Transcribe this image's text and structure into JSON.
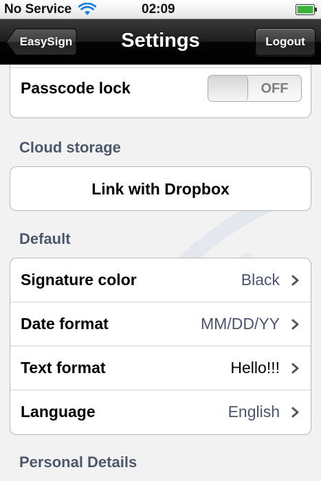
{
  "status_bar": {
    "carrier": "No Service",
    "time": "02:09"
  },
  "nav": {
    "back_label": "EasySign",
    "title": "Settings",
    "logout_label": "Logout"
  },
  "passcode": {
    "label": "Passcode lock",
    "toggle_state": "OFF"
  },
  "cloud": {
    "header": "Cloud storage",
    "link_label": "Link with Dropbox"
  },
  "default": {
    "header": "Default",
    "rows": [
      {
        "label": "Signature color",
        "value": "Black"
      },
      {
        "label": "Date format",
        "value": "MM/DD/YY"
      },
      {
        "label": "Text format",
        "value": "Hello!!!"
      },
      {
        "label": "Language",
        "value": "English"
      }
    ]
  },
  "personal": {
    "header": "Personal Details"
  },
  "colors": {
    "section_header": "#4c566c",
    "value_text": "#4a5470",
    "toggle_on": "#2f6fd0"
  }
}
